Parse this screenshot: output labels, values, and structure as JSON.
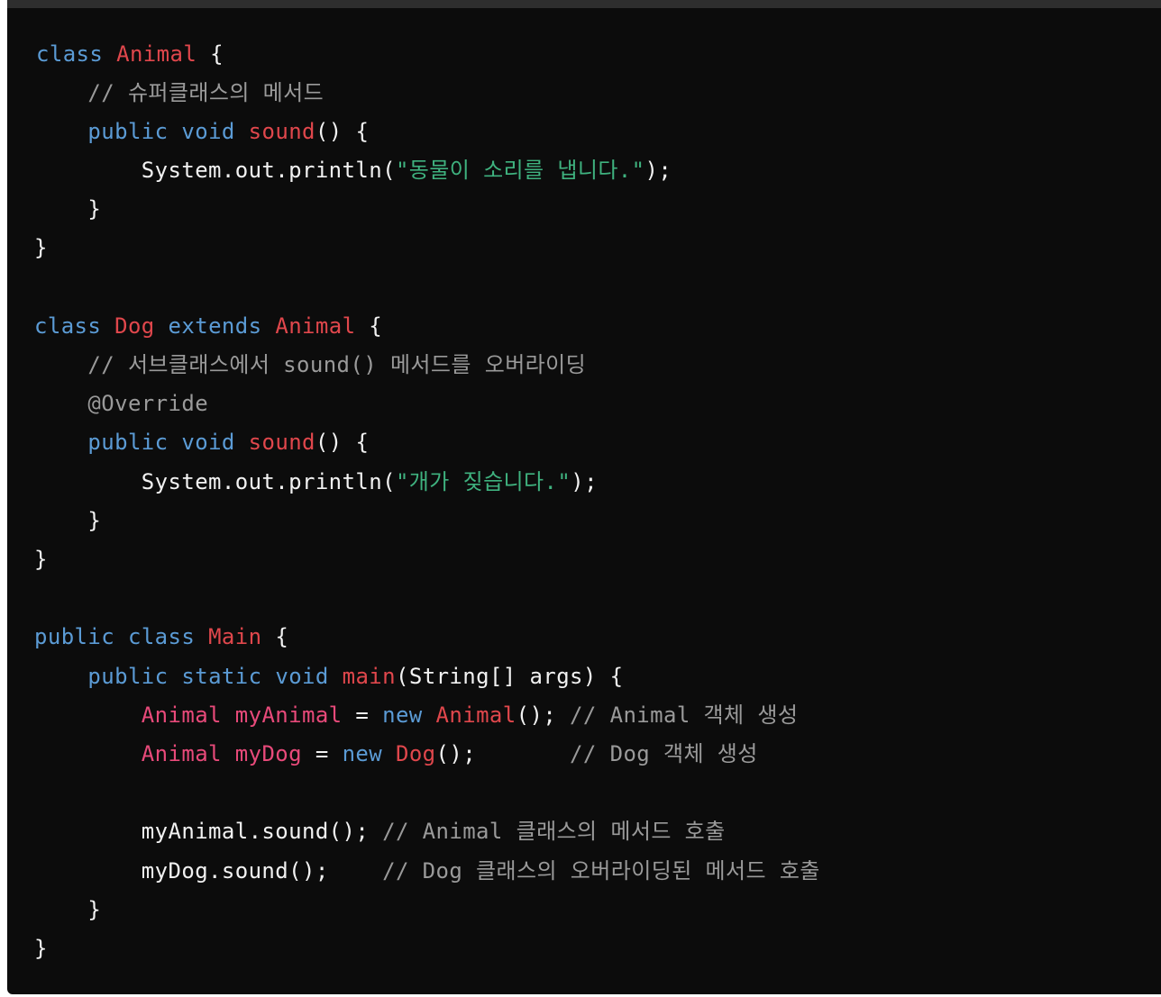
{
  "code": {
    "language": "java",
    "lines": [
      [
        [
          "kw",
          "class"
        ],
        [
          "pl",
          " "
        ],
        [
          "cls",
          "Animal"
        ],
        [
          "pl",
          " {"
        ]
      ],
      [
        [
          "cm",
          "    // 슈퍼클래스의 메서드"
        ]
      ],
      [
        [
          "pl",
          "    "
        ],
        [
          "kw",
          "public"
        ],
        [
          "pl",
          " "
        ],
        [
          "kw",
          "void"
        ],
        [
          "pl",
          " "
        ],
        [
          "fn",
          "sound"
        ],
        [
          "pl",
          "() {"
        ]
      ],
      [
        [
          "pl",
          "        System.out.println("
        ],
        [
          "str",
          "\"동물이 소리를 냅니다.\""
        ],
        [
          "pl",
          ");"
        ]
      ],
      [
        [
          "pl",
          "    }"
        ]
      ],
      [
        [
          "pl",
          "}"
        ]
      ],
      [
        [
          "pl",
          ""
        ]
      ],
      [
        [
          "kw",
          "class"
        ],
        [
          "pl",
          " "
        ],
        [
          "cls",
          "Dog"
        ],
        [
          "pl",
          " "
        ],
        [
          "kw",
          "extends"
        ],
        [
          "pl",
          " "
        ],
        [
          "cls",
          "Animal"
        ],
        [
          "pl",
          " {"
        ]
      ],
      [
        [
          "cm",
          "    // 서브클래스에서 sound() 메서드를 오버라이딩"
        ]
      ],
      [
        [
          "cm",
          "    @Override"
        ]
      ],
      [
        [
          "pl",
          "    "
        ],
        [
          "kw",
          "public"
        ],
        [
          "pl",
          " "
        ],
        [
          "kw",
          "void"
        ],
        [
          "pl",
          " "
        ],
        [
          "fn",
          "sound"
        ],
        [
          "pl",
          "() {"
        ]
      ],
      [
        [
          "pl",
          "        System.out.println("
        ],
        [
          "str",
          "\"개가 짖습니다.\""
        ],
        [
          "pl",
          ");"
        ]
      ],
      [
        [
          "pl",
          "    }"
        ]
      ],
      [
        [
          "pl",
          "}"
        ]
      ],
      [
        [
          "pl",
          ""
        ]
      ],
      [
        [
          "kw",
          "public"
        ],
        [
          "pl",
          " "
        ],
        [
          "kw",
          "class"
        ],
        [
          "pl",
          " "
        ],
        [
          "cls",
          "Main"
        ],
        [
          "pl",
          " {"
        ]
      ],
      [
        [
          "pl",
          "    "
        ],
        [
          "kw",
          "public"
        ],
        [
          "pl",
          " "
        ],
        [
          "kw",
          "static"
        ],
        [
          "pl",
          " "
        ],
        [
          "kw",
          "void"
        ],
        [
          "pl",
          " "
        ],
        [
          "fn",
          "main"
        ],
        [
          "pl",
          "(String[] args) {"
        ]
      ],
      [
        [
          "pl",
          "        "
        ],
        [
          "var",
          "Animal myAnimal"
        ],
        [
          "pl",
          " = "
        ],
        [
          "kw",
          "new"
        ],
        [
          "pl",
          " "
        ],
        [
          "cls",
          "Animal"
        ],
        [
          "pl",
          "(); "
        ],
        [
          "cm",
          "// Animal 객체 생성"
        ]
      ],
      [
        [
          "pl",
          "        "
        ],
        [
          "var",
          "Animal myDog"
        ],
        [
          "pl",
          " = "
        ],
        [
          "kw",
          "new"
        ],
        [
          "pl",
          " "
        ],
        [
          "cls",
          "Dog"
        ],
        [
          "pl",
          "();       "
        ],
        [
          "cm",
          "// Dog 객체 생성"
        ]
      ],
      [
        [
          "pl",
          ""
        ]
      ],
      [
        [
          "pl",
          "        myAnimal.sound(); "
        ],
        [
          "cm",
          "// Animal 클래스의 메서드 호출"
        ]
      ],
      [
        [
          "pl",
          "        myDog.sound();    "
        ],
        [
          "cm",
          "// Dog 클래스의 오버라이딩된 메서드 호출"
        ]
      ],
      [
        [
          "pl",
          "    }"
        ]
      ],
      [
        [
          "pl",
          "}"
        ]
      ]
    ]
  },
  "colors": {
    "background": "#0c0c0c",
    "keyword": "#5b9bd5",
    "class_name": "#e0474c",
    "string": "#3fb27f",
    "comment": "#9a9a9a",
    "plain": "#f2f2f2"
  }
}
